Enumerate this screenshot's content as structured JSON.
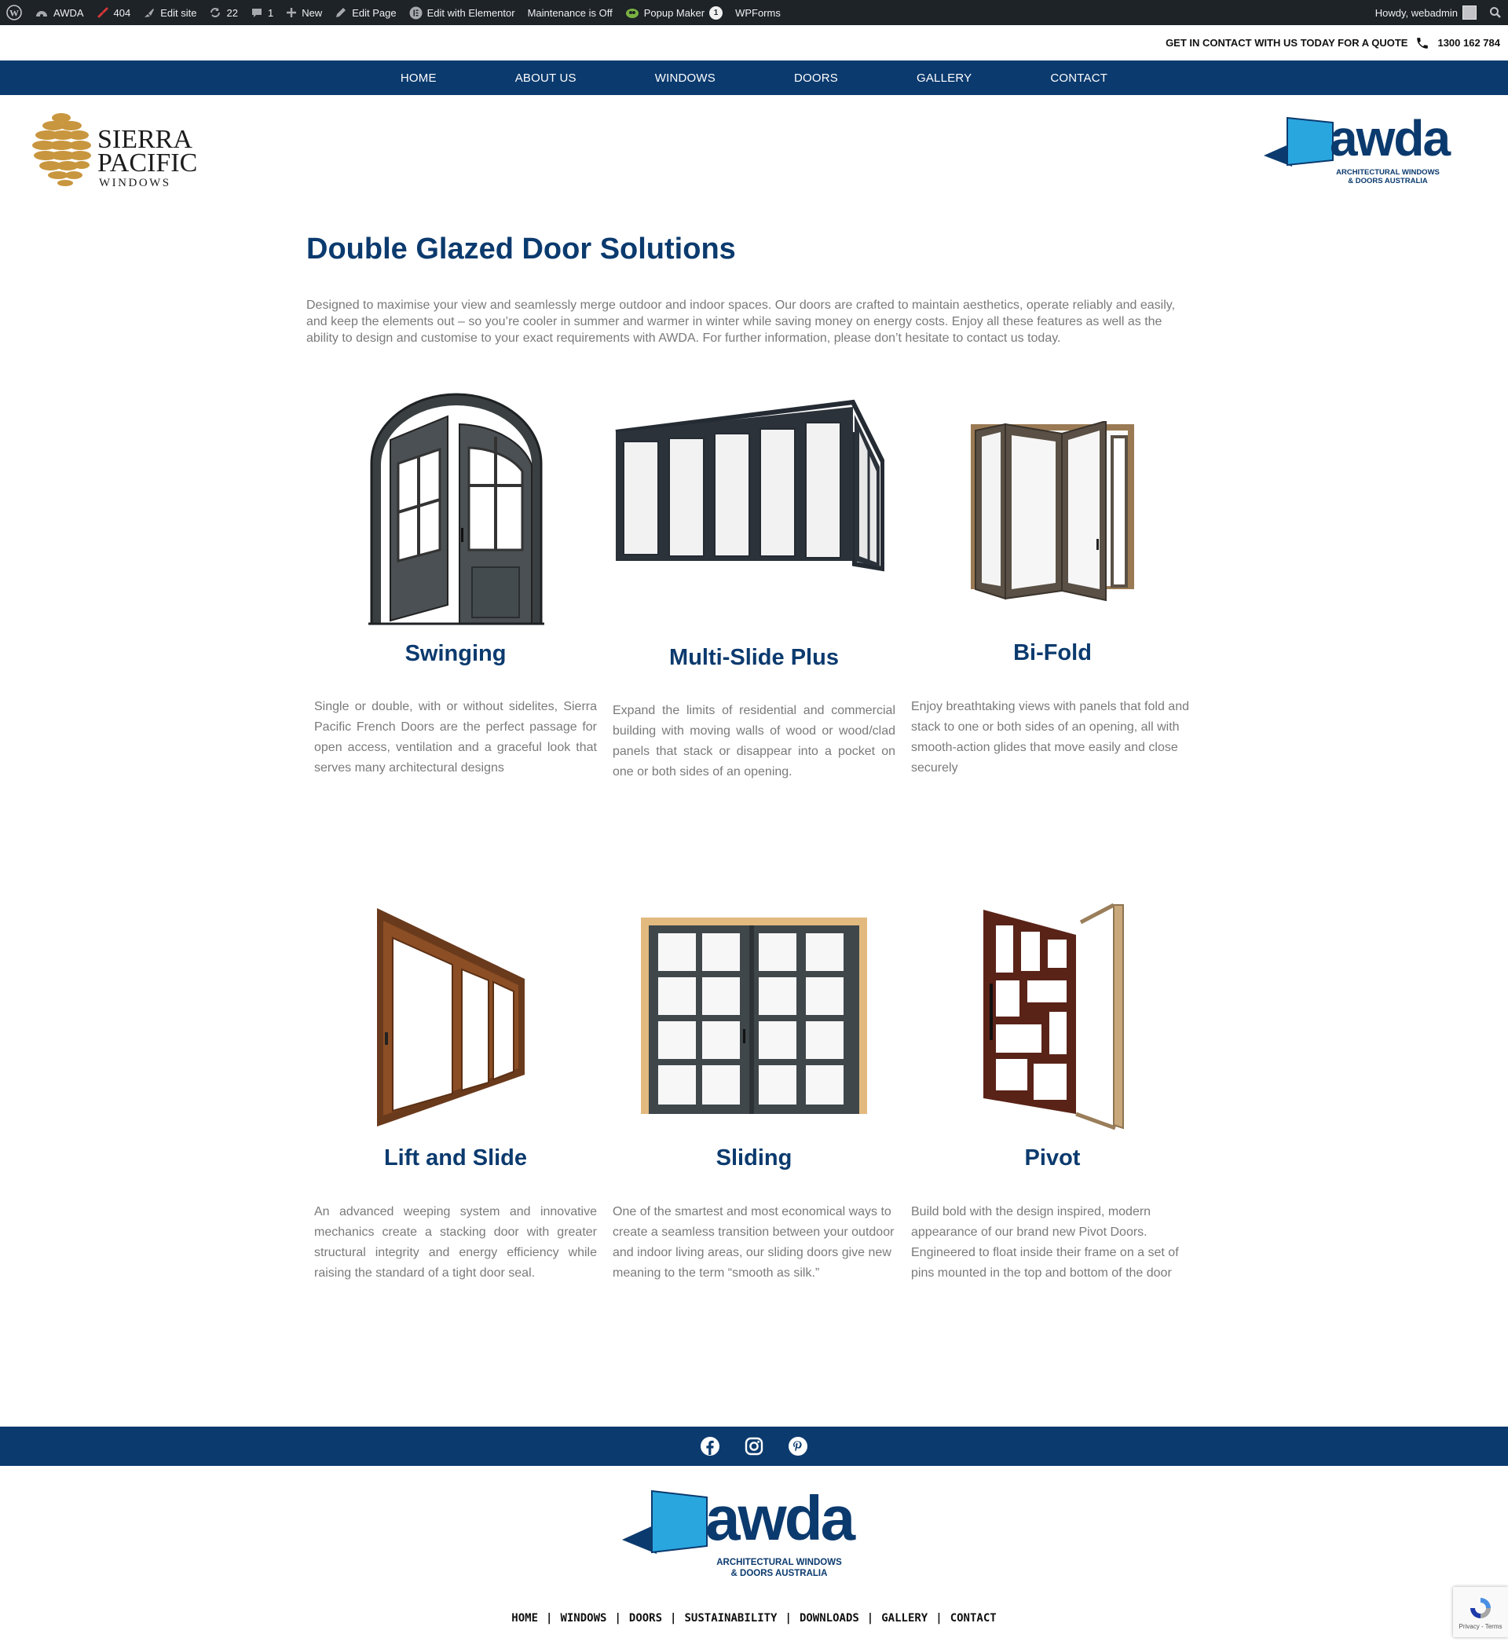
{
  "admin_bar": {
    "site_name": "AWDA",
    "errors": "404",
    "edit_site": "Edit site",
    "updates": "22",
    "comments": "1",
    "new": "New",
    "edit_page": "Edit Page",
    "elementor": "Edit with Elementor",
    "maintenance": "Maintenance is Off",
    "popup_maker": "Popup Maker",
    "popup_count": "1",
    "wpforms": "WPForms",
    "howdy": "Howdy, webadmin"
  },
  "top_strip": {
    "cta": "GET IN CONTACT WITH US TODAY FOR A QUOTE",
    "phone": "1300 162 784"
  },
  "nav": [
    "HOME",
    "ABOUT US",
    "WINDOWS",
    "DOORS",
    "GALLERY",
    "CONTACT"
  ],
  "logos": {
    "sierra_line1": "SIERRA",
    "sierra_line2": "PACIFIC",
    "sierra_line3": "WINDOWS",
    "awda_word": "awda",
    "awda_line1": "ARCHITECTURAL WINDOWS",
    "awda_line2": "& DOORS AUSTRALIA"
  },
  "page": {
    "title": "Double Glazed Door Solutions",
    "intro": "Designed to maximise your view and seamlessly merge outdoor and indoor spaces. Our doors are crafted to maintain aesthetics, operate reliably and easily, and keep the elements out – so you’re cooler in summer and warmer in winter while saving money on energy costs. Enjoy all these features as well as the ability to design and customise to your exact requirements with AWDA. For further information, please don’t hesitate to contact us today."
  },
  "cards": [
    {
      "title": "Swinging",
      "text": "Single or double, with or without sidelites, Sierra Pacific French Doors are the perfect passage for open access, ventilation and a graceful look that serves many architectural designs"
    },
    {
      "title": "Multi-Slide Plus",
      "text": "Expand the limits of residential and commercial building with moving walls of wood or wood/clad panels that stack or disappear into a pocket on one or both sides of an opening."
    },
    {
      "title": "Bi-Fold",
      "text": "Enjoy breathtaking views with panels that fold and stack to one or both sides of an opening, all with smooth-action glides that move easily and close securely"
    },
    {
      "title": "Lift and Slide",
      "text": "An advanced weeping system and innovative mechanics create a stacking door with greater structural integrity and energy efficiency while raising the standard of a tight door seal."
    },
    {
      "title": "Sliding",
      "text": "One of the smartest and most economical ways to create a seamless transition between your outdoor and indoor living areas, our sliding doors give new meaning to the term “smooth as silk.”"
    },
    {
      "title": "Pivot",
      "text": "Build bold with the design inspired, modern appearance of our brand new Pivot Doors. Engineered to float inside their frame on a set of pins mounted in the top and bottom of the door"
    }
  ],
  "footer": {
    "nav": [
      "HOME",
      "WINDOWS",
      "DOORS",
      "SUSTAINABILITY",
      "DOWNLOADS",
      "GALLERY",
      "CONTACT"
    ],
    "recaptcha": "Privacy - Terms"
  },
  "colors": {
    "navy": "#0b3a6e",
    "awda_blue": "#2aa6df",
    "admin_bar": "#1d2327"
  }
}
